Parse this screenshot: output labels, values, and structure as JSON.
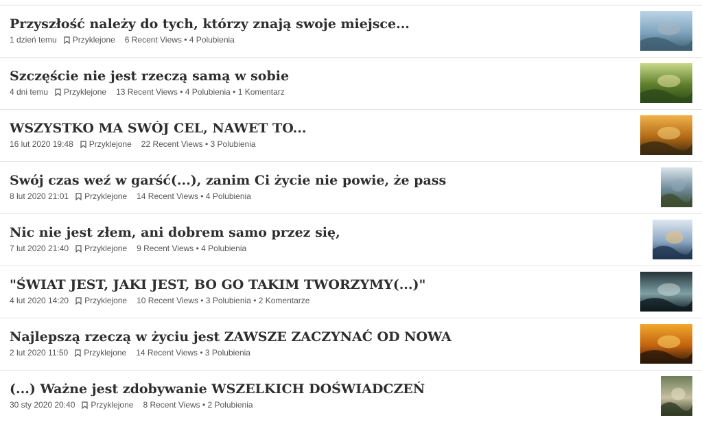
{
  "pin_label": "Przyklejone",
  "posts": [
    {
      "title": "Przyszłość należy do tych, którzy znają swoje miejsce...",
      "date": "1 dzień temu",
      "stats": "6 Recent Views • 4 Polubienia",
      "thumb": "mountain-lake-path",
      "colors": [
        "#bcd4e6",
        "#7da3bd",
        "#3f5f72",
        "#a9b7bf"
      ]
    },
    {
      "title": "Szczęście nie jest rzeczą samą w sobie",
      "date": "4 dni temu",
      "stats": "13 Recent Views • 4 Polubienia • 1 Komentarz",
      "thumb": "tree-sunlight",
      "colors": [
        "#c9d98a",
        "#5d7d2a",
        "#2d4a1a",
        "#e8e3a0"
      ]
    },
    {
      "title": "WSZYSTKO MA SWÓJ CEL, NAWET TO...",
      "date": "16 lut 2020 19:48",
      "stats": "22 Recent Views • 3 Polubienia",
      "thumb": "sunset-forest",
      "colors": [
        "#f1b24a",
        "#b26a16",
        "#3b2a10",
        "#f7d27a"
      ]
    },
    {
      "title": "Swój czas weź w garść(...), zanim Ci życie nie powie, że pass",
      "date": "8 lut 2020 21:01",
      "stats": "14 Recent Views • 4 Polubienia",
      "thumb": "book-cover-buddha",
      "colors": [
        "#d9e4ea",
        "#6d8a9a",
        "#3d4c2e",
        "#8fa7b8"
      ]
    },
    {
      "title": "Nic nie jest złem, ani dobrem samo przez się,",
      "date": "7 lut 2020 21:40",
      "stats": "9 Recent Views • 4 Polubienia",
      "thumb": "cloudy-sky",
      "colors": [
        "#dfe7ee",
        "#8ba8c4",
        "#1f3550",
        "#f0c27a"
      ]
    },
    {
      "title": "\"ŚWIAT JEST, JAKI JEST, BO GO TAKIM TWORZYMY(...)\"",
      "date": "4 lut 2020 14:20",
      "stats": "10 Recent Views • 3 Polubienia • 2 Komentarze",
      "thumb": "elephant-forest",
      "colors": [
        "#24343a",
        "#7fa0a6",
        "#0e1a1e",
        "#c7d5d3"
      ]
    },
    {
      "title": "Najlepszą rzeczą w życiu jest ZAWSZE ZACZYNAĆ OD NOWA",
      "date": "2 lut 2020 11:50",
      "stats": "14 Recent Views • 3 Polubienia",
      "thumb": "heart-hands-sunset",
      "colors": [
        "#f2a92c",
        "#c2620f",
        "#2a1808",
        "#ffd56a"
      ]
    },
    {
      "title": "(...) Ważne jest zdobywanie WSZELKICH DOŚWIADCZEŃ",
      "date": "30 sty 2020 20:40",
      "stats": "8 Recent Views • 2 Polubienia",
      "thumb": "tree-tunnel",
      "colors": [
        "#6e7d5a",
        "#c7c0a0",
        "#2f3a22",
        "#e6dfc6"
      ]
    }
  ]
}
